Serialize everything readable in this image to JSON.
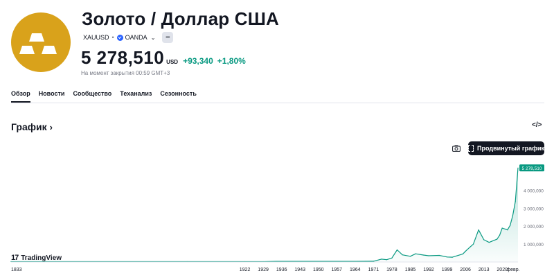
{
  "symbol": {
    "title": "Золото / Доллар США",
    "ticker": "XAUUSD",
    "exchange": "OANDA",
    "logo_icon": "gold-bars-icon",
    "logo_color": "#d9a21b"
  },
  "quote": {
    "price": "5 278,510",
    "currency": "USD",
    "change_abs": "+93,340",
    "change_pct": "+1,80%",
    "change_color": "#089981",
    "closed_note": "На момент закрытия 00:59 GMT+3"
  },
  "tabs": [
    {
      "label": "Обзор",
      "active": true
    },
    {
      "label": "Новости",
      "active": false
    },
    {
      "label": "Сообщество",
      "active": false
    },
    {
      "label": "Теханализ",
      "active": false
    },
    {
      "label": "Сезонность",
      "active": false
    }
  ],
  "section": {
    "title": "График",
    "embed_icon": "</>"
  },
  "toolbar": {
    "camera_icon": "camera-icon",
    "advanced_chart_label": "Продвинутый график"
  },
  "branding": {
    "label": "TradingView",
    "mark": "17"
  },
  "chart_data": {
    "type": "area",
    "x": [
      1833,
      1850,
      1900,
      1922,
      1929,
      1934,
      1936,
      1943,
      1950,
      1957,
      1964,
      1968,
      1971,
      1974,
      1976,
      1978,
      1980,
      1982,
      1985,
      1987,
      1990,
      1992,
      1996,
      1999,
      2001,
      2005,
      2006,
      2008,
      2009,
      2011,
      2013,
      2015,
      2018,
      2019,
      2020,
      2022,
      2023,
      2024,
      2025,
      2026
    ],
    "values": [
      20,
      20,
      20,
      20,
      20,
      35,
      35,
      35,
      35,
      35,
      35,
      40,
      42,
      160,
      130,
      220,
      680,
      400,
      320,
      460,
      390,
      350,
      370,
      280,
      270,
      450,
      600,
      870,
      1000,
      1800,
      1250,
      1100,
      1280,
      1500,
      1900,
      1800,
      2050,
      2600,
      3400,
      5278.51
    ],
    "x_ticks": [
      "1833",
      "1922",
      "1929",
      "1936",
      "1943",
      "1950",
      "1957",
      "1964",
      "1971",
      "1978",
      "1985",
      "1992",
      "1999",
      "2006",
      "2013",
      "2020",
      "февр."
    ],
    "y_ticks": [
      1000,
      2000,
      3000,
      4000
    ],
    "y_tick_labels": [
      "1 000,000",
      "2 000,000",
      "3 000,000",
      "4 000,000"
    ],
    "y_range": [
      0,
      5600
    ],
    "last_value_label": "5 278,510",
    "line_color": "#089981",
    "grid": false
  }
}
